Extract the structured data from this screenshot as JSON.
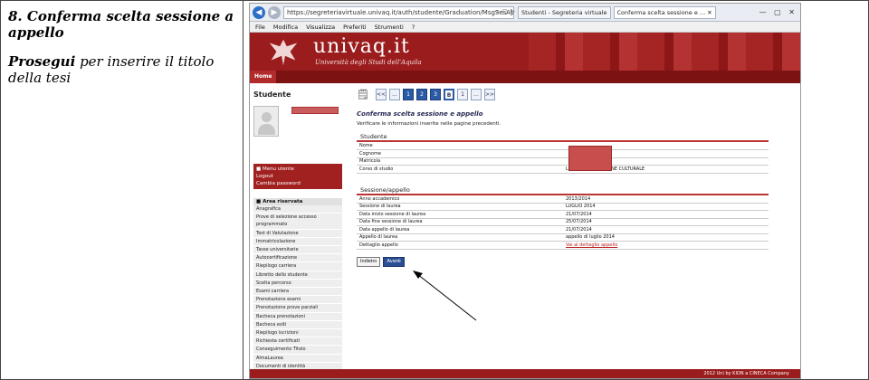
{
  "slide": {
    "title": "8. Conferma scelta sessione a appello",
    "subtitle_bold": "Prosegui",
    "subtitle_rest": "per inserire il titolo della tesi"
  },
  "browser": {
    "url": "https://segreteriavirtuale.univaq.it/auth/studente/Graduation/MsgSesAppPost.do",
    "url_icons": "⌕ ▢ ↻",
    "tabs": [
      "Studenti - Segreteria virtuale",
      "Conferma scelta sessione e ... ✕"
    ],
    "window_buttons": "— ▢ ✕",
    "menu": [
      "File",
      "Modifica",
      "Visualizza",
      "Preferiti",
      "Strumenti",
      "?"
    ]
  },
  "banner": {
    "brand": "univaq.it",
    "subtitle": "Università degli Studi dell'Aquila",
    "home": "Home"
  },
  "sidebar": {
    "heading": "Studente",
    "red_menu": [
      "■ Menu utente",
      "Logout",
      "Cambia password"
    ],
    "area_heading": "■ Area riservata",
    "items": [
      "Anagrafica",
      "Prove di selezione accesso programmato",
      "Test di Valutazione",
      "Immatricolazione",
      "Tasse universitarie",
      "Autocertificazione",
      "Riepilogo carriera",
      "Libretto dello studente",
      "Scelta percorso",
      "Esami carriera",
      "Prenotazione esami",
      "Prenotazione prove parziali",
      "Bacheca prenotazioni",
      "Bacheca esiti",
      "Riepilogo iscrizioni",
      "Richiesta certificati",
      "Conseguimento Titolo",
      "AlmaLaurea",
      "Documenti di identità"
    ]
  },
  "main": {
    "pager": [
      "<<",
      "...",
      "1",
      "2",
      "3",
      "B",
      "1",
      "...",
      ">>"
    ],
    "title": "Conferma scelta sessione e appello",
    "desc": "Verificare le informazioni inserite nelle pagine precedenti.",
    "student_section": "Studente",
    "student_rows": [
      {
        "label": "Nome",
        "value": ""
      },
      {
        "label": "Cognome",
        "value": ""
      },
      {
        "label": "Matricola",
        "value": ""
      },
      {
        "label": "Corso di studio",
        "value": "LINGUE E MEDIAZIONE CULTURALE"
      }
    ],
    "session_section": "Sessione/appello",
    "session_rows": [
      {
        "label": "Anno accademico",
        "value": "2013/2014"
      },
      {
        "label": "Sessione di laurea",
        "value": "LUGLIO 2014"
      },
      {
        "label": "Data inizio sessione di laurea",
        "value": "21/07/2014"
      },
      {
        "label": "Data fine sessione di laurea",
        "value": "25/07/2014"
      },
      {
        "label": "Data appello di laurea",
        "value": "21/07/2014"
      },
      {
        "label": "Appello di laurea",
        "value": "appello di luglio 2014"
      },
      {
        "label": "Dettaglio appello",
        "value": "Vai al dettaglio appello"
      }
    ],
    "back_label": "Indietro",
    "next_label": "Avanti"
  },
  "footer": "2012 Uni by KION a CINECA Company",
  "colors": {
    "brand_red": "#9b1c1c",
    "button_blue": "#2a4d93"
  }
}
